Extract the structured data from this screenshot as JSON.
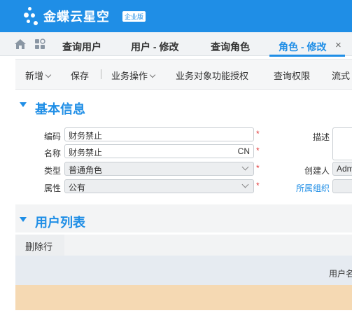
{
  "app": {
    "brand": "金蝶云星空",
    "edition": "企业版"
  },
  "tabs": [
    {
      "label": "查询用户"
    },
    {
      "label": "用户 - 修改"
    },
    {
      "label": "查询角色"
    },
    {
      "label": "角色 - 修改"
    }
  ],
  "tab_close": "×",
  "toolbar": {
    "new": "新增",
    "save": "保存",
    "business_ops": "业务操作",
    "object_auth": "业务对象功能授权",
    "query_auth": "查询权限",
    "flow": "流式"
  },
  "basic_info": {
    "title": "基本信息",
    "code_label": "编码",
    "code_value": "财务禁止",
    "name_label": "名称",
    "name_value": "财务禁止",
    "name_lang": "CN",
    "type_label": "类型",
    "type_value": "普通角色",
    "attr_label": "属性",
    "attr_value": "公有",
    "desc_label": "描述",
    "creator_label": "创建人",
    "creator_value": "Adm",
    "org_label": "所属组织",
    "required_mark": "*"
  },
  "user_list": {
    "title": "用户列表",
    "delete_row": "删除行",
    "column_user": "用户名"
  },
  "colors": {
    "brand_blue": "#1f8ee6",
    "required_red": "#e03c3c",
    "selected_row": "#f5d9b3"
  }
}
